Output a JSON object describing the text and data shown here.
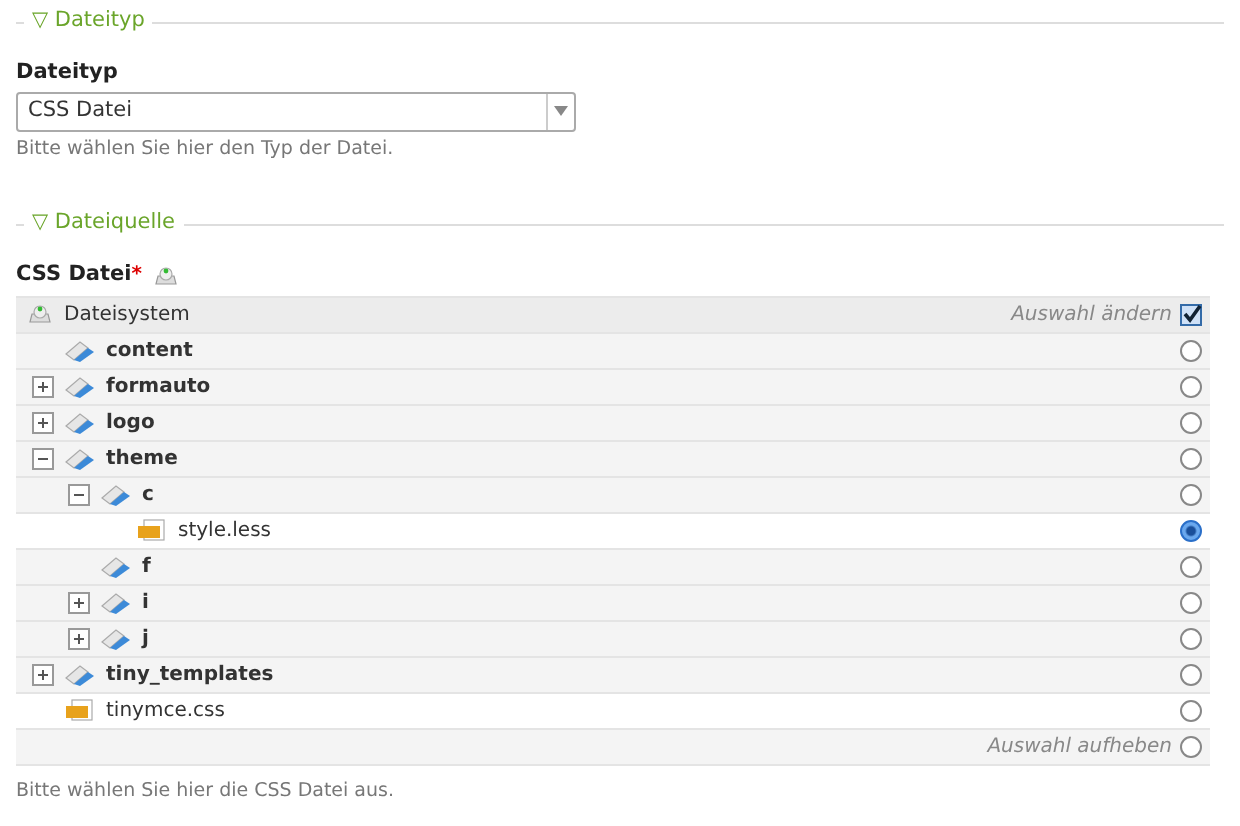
{
  "sections": [
    {
      "legend": "▽ Dateityp",
      "field": {
        "kind": "select",
        "label": "Dateityp",
        "value": "CSS Datei",
        "help": "Bitte wählen Sie hier den Typ der Datei."
      }
    },
    {
      "legend": "▽ Dateiquelle",
      "field": {
        "kind": "tree",
        "label": "CSS Datei",
        "required_mark": "*",
        "root": "Dateisystem",
        "change_label": "Auswahl ändern",
        "change_checked": true,
        "clear_label": "Auswahl aufheben",
        "clear_selected": false,
        "help": "Bitte wählen Sie hier die CSS Datei aus.",
        "items": [
          {
            "kind": "folder",
            "label": "content",
            "selected": false
          },
          {
            "kind": "folder",
            "label": "formauto",
            "expanded": false,
            "selected": false
          },
          {
            "kind": "folder",
            "label": "logo",
            "expanded": false,
            "selected": false
          },
          {
            "kind": "folder",
            "label": "theme",
            "expanded": true,
            "selected": false,
            "children": [
              {
                "kind": "folder",
                "label": "c",
                "expanded": true,
                "selected": false,
                "children": [
                  {
                    "kind": "file",
                    "label": "style.less",
                    "selected": true
                  }
                ]
              },
              {
                "kind": "folder",
                "label": "f",
                "selected": false
              },
              {
                "kind": "folder",
                "label": "i",
                "expanded": false,
                "selected": false
              },
              {
                "kind": "folder",
                "label": "j",
                "expanded": false,
                "selected": false
              }
            ]
          },
          {
            "kind": "folder",
            "label": "tiny_templates",
            "expanded": false,
            "selected": false
          },
          {
            "kind": "file",
            "label": "tinymce.css",
            "selected": false
          }
        ]
      }
    }
  ]
}
